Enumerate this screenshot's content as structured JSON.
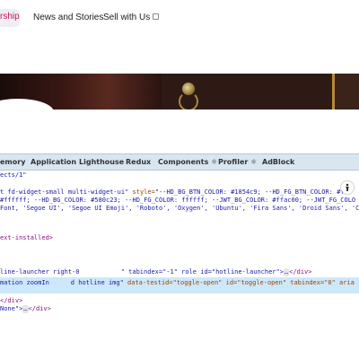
{
  "nav": {
    "active_label": "rship",
    "news_label": "News and Stories",
    "sell_label": "Sell with Us"
  },
  "devtools": {
    "tabs": [
      "emory",
      "Application",
      "Lighthouse",
      "Redux",
      "Components ⚛",
      "Profiler ⚛",
      "AdBlock"
    ],
    "breadcrumb": "ects/1\"",
    "lines": {
      "l1_tag": "t fd-widget-small multi-widget-ui\" ",
      "l1_attr": "style=",
      "l1_val": "\"--HD_BG_BTN_COLOR: #1854c9; --HD_FG_BTN_COLOR: #ff",
      "l2": "#ffffff; --HD_BG_COLOR: #580c23; --HD_FG_COLOR: ffffff; --JWT_BG_COLOR: #ffac00; --JWT_FG_COLO",
      "l3": "Font, 'Segoe UI', 'Segoe UI Emoji', 'Roboto', 'Oxygen', 'Ubuntu', 'Fira Sans', 'Droid Sans', 'C",
      "l4": "ext-installed>",
      "l5_a": "line-launcher right-0",
      "l5_b": "\" tabindex=\"-1\" role id=\"hotline-launcher\">",
      "l5_ellip": "…",
      "l5_end": "</div>",
      "l6_a": "mation zoomIn",
      "l6_b": "d hotline img\"",
      "l6_c": " data-testid=\"toggle-open\" id=\"toggle-open\" tabindex=\"0\" aria",
      "l7": "</div>",
      "l8_a": "None\">",
      "l8_ellip": "…",
      "l8_end": "</div>"
    },
    "inspect_icon": "inspect-icon"
  }
}
